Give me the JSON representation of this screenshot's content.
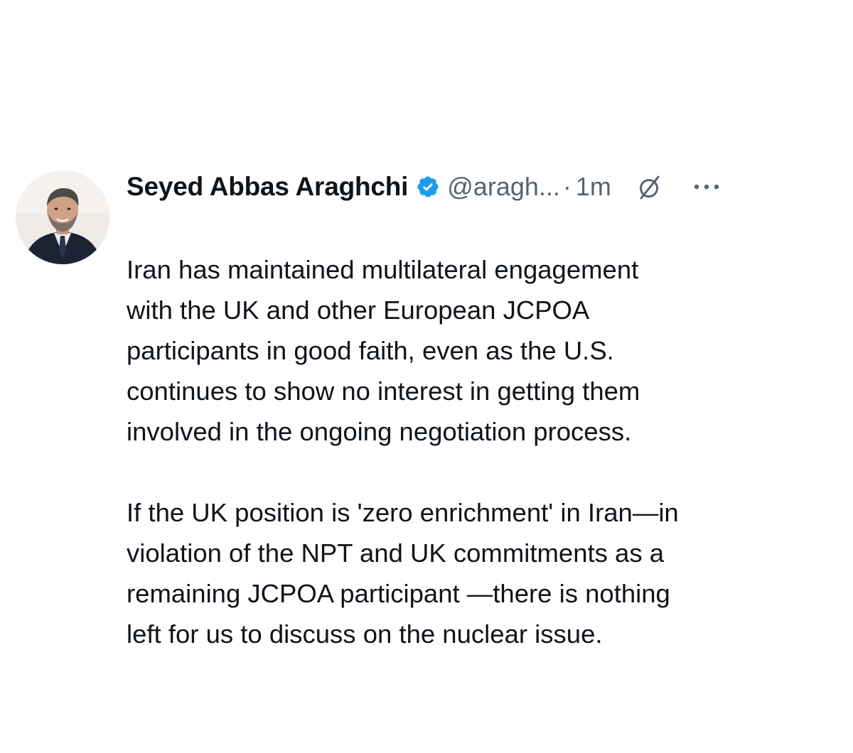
{
  "tweet": {
    "author_name": "Seyed Abbas Araghchi",
    "handle": "@aragh...",
    "separator": "·",
    "time": "1m",
    "paragraphs": [
      "Iran has maintained multilateral engagement\nwith the UK and other European JCPOA\nparticipants in good faith, even as the U.S.\ncontinues to show no interest in getting them\ninvolved in the ongoing negotiation process.\n",
      "If the UK position is 'zero enrichment' in Iran—in\nviolation of the NPT and UK commitments as a\nremaining JCPOA participant —there is nothing\nleft for us to discuss on the nuclear issue."
    ]
  },
  "icons": {
    "verified": "verified-badge-icon",
    "grok": "grok-icon",
    "more": "more-options-icon",
    "avatar": "profile-photo"
  },
  "colors": {
    "text": "#0f1419",
    "secondary": "#536471",
    "verified_blue": "#1d9bf0",
    "background": "#ffffff"
  }
}
